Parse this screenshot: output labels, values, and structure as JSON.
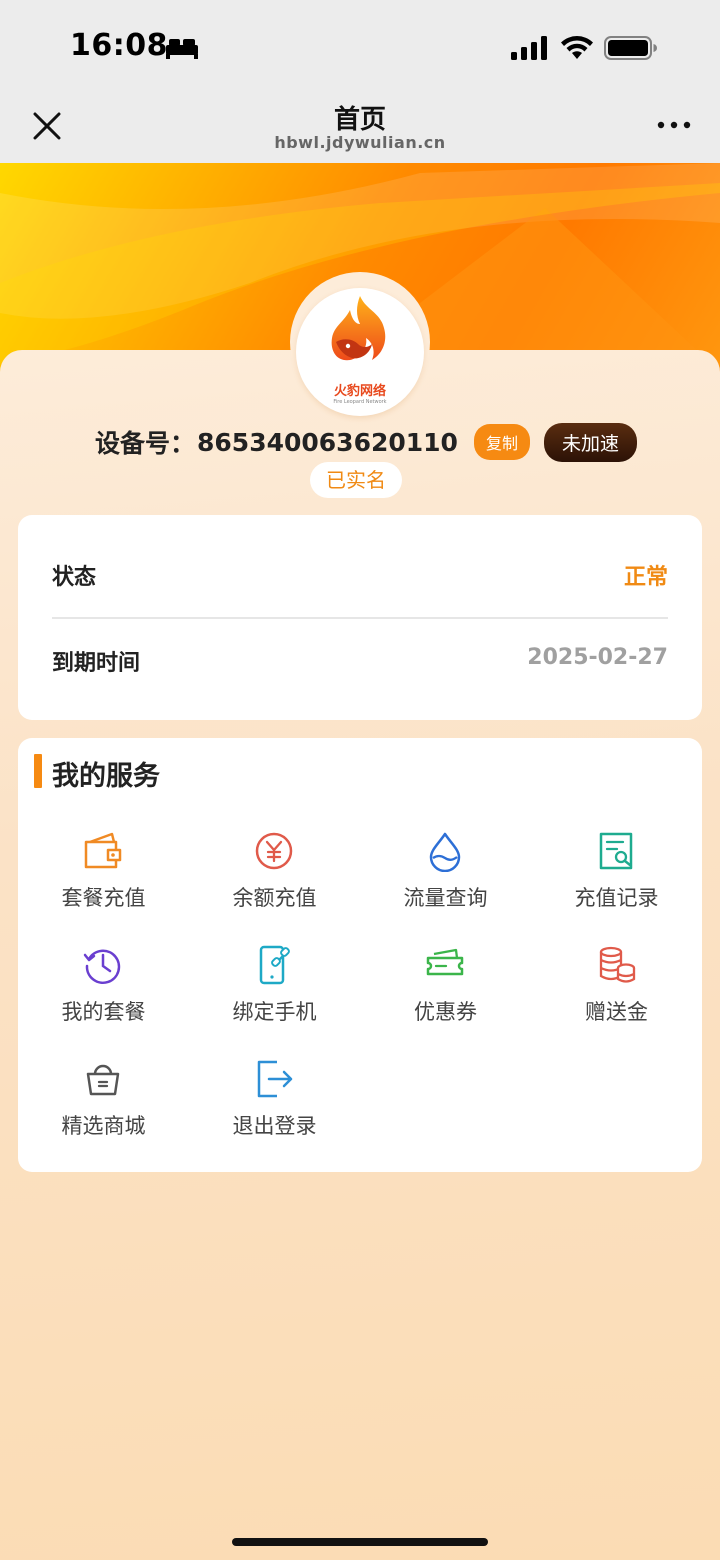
{
  "status_bar": {
    "time": "16:08"
  },
  "nav": {
    "title": "首页",
    "url": "hbwl.jdywulian.cn"
  },
  "logo": {
    "name": "火豹网络",
    "subtitle": "Fire Leopard Network"
  },
  "device": {
    "label": "设备号：",
    "id": "865340063620110",
    "copy_label": "复制",
    "speed_label": "未加速",
    "realname_label": "已实名"
  },
  "status_card": {
    "status_label": "状态",
    "status_value": "正常",
    "expire_label": "到期时间",
    "expire_value": "2025-02-27"
  },
  "services": {
    "title": "我的服务",
    "items": [
      {
        "label": "套餐充值",
        "icon": "wallet-icon"
      },
      {
        "label": "余额充值",
        "icon": "yuan-coin-icon"
      },
      {
        "label": "流量查询",
        "icon": "droplet-icon"
      },
      {
        "label": "充值记录",
        "icon": "record-search-icon"
      },
      {
        "label": "我的套餐",
        "icon": "history-clock-icon"
      },
      {
        "label": "绑定手机",
        "icon": "phone-link-icon"
      },
      {
        "label": "优惠券",
        "icon": "coupon-icon"
      },
      {
        "label": "赠送金",
        "icon": "coins-stack-icon"
      },
      {
        "label": "精选商城",
        "icon": "shopping-basket-icon"
      },
      {
        "label": "退出登录",
        "icon": "logout-icon"
      }
    ]
  },
  "colors": {
    "accent": "#f68a12",
    "status_normal": "#f08a14",
    "expire_gray": "#a0a0a0",
    "speed_dark": "#3a1a08"
  }
}
